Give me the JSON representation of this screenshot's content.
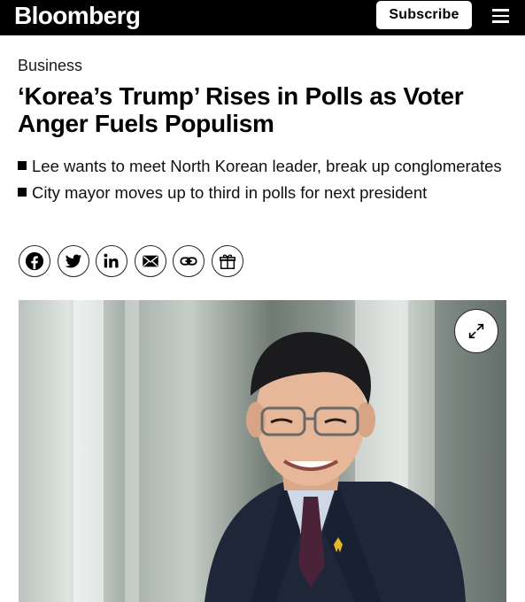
{
  "header": {
    "logo": "Bloomberg",
    "subscribe_label": "Subscribe",
    "menu_icon": "hamburger-menu-icon"
  },
  "article": {
    "section": "Business",
    "headline": "‘Korea’s Trump’ Rises in Polls as Voter Anger Fuels Populism",
    "bullets": [
      "Lee wants to meet North Korean leader, break up conglomerates",
      "City mayor moves up to third in polls for next president"
    ]
  },
  "share_icons": [
    "facebook-icon",
    "twitter-icon",
    "linkedin-icon",
    "email-icon",
    "link-icon",
    "gift-icon"
  ],
  "hero_image": {
    "expand_icon": "expand-icon"
  },
  "colors": {
    "topbar": "#000000",
    "background": "#ffffff",
    "text": "#000000"
  }
}
